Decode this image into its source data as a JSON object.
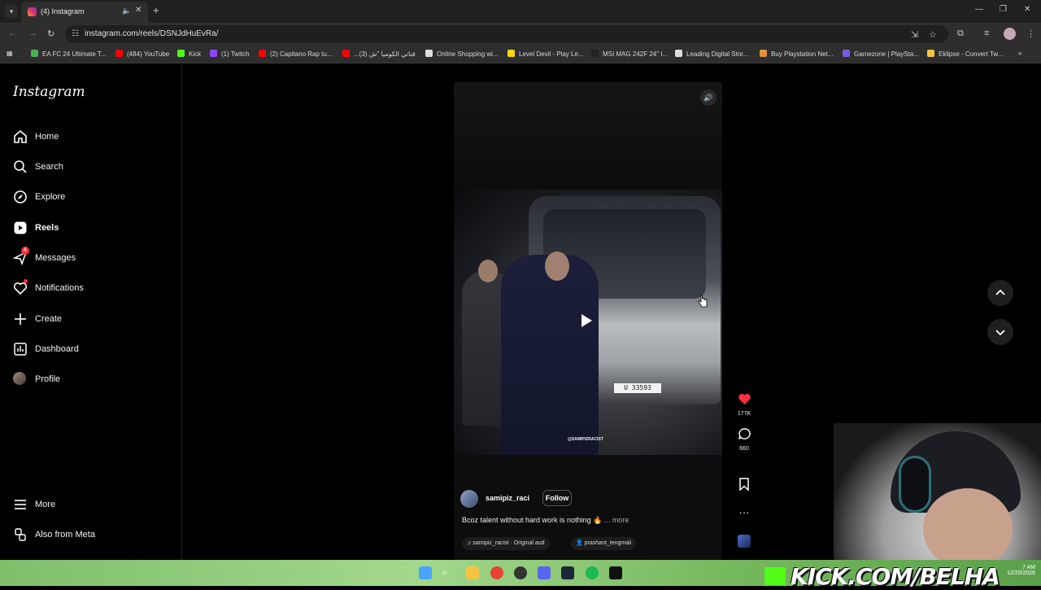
{
  "browser": {
    "tab_title": "(4) Instagram",
    "url": "instagram.com/reels/DSNJdHuEvRa/",
    "bookmarks": [
      {
        "label": "EA FC 24 Ultimate T...",
        "color": "#4caf50"
      },
      {
        "label": "(484) YouTube",
        "color": "#ff0000"
      },
      {
        "label": "Kick",
        "color": "#53fc18"
      },
      {
        "label": "(1) Twitch",
        "color": "#9146ff"
      },
      {
        "label": "(2) Capitano Rap tu...",
        "color": "#ff0000"
      },
      {
        "label": "...قناتي الكوميا \"ش (3)",
        "color": "#ff0000"
      },
      {
        "label": "Online Shopping wi...",
        "color": "#dddddd"
      },
      {
        "label": "Level Devil - Play Le...",
        "color": "#f5d90a"
      },
      {
        "label": "MSI MAG 242F 24\" I...",
        "color": "#222222"
      },
      {
        "label": "Leading Digital Stor...",
        "color": "#dddddd"
      },
      {
        "label": "Buy Playstation Net...",
        "color": "#e0913a"
      },
      {
        "label": "Gamezone | PlaySta...",
        "color": "#7a5ce0"
      },
      {
        "label": "Eklipse - Convert Tw...",
        "color": "#f5c542"
      }
    ]
  },
  "sidebar": {
    "logo": "Instagram",
    "items": [
      {
        "label": "Home",
        "icon": "home-icon"
      },
      {
        "label": "Search",
        "icon": "search-icon"
      },
      {
        "label": "Explore",
        "icon": "explore-icon"
      },
      {
        "label": "Reels",
        "icon": "reels-icon",
        "active": true
      },
      {
        "label": "Messages",
        "icon": "messages-icon",
        "badge": "4"
      },
      {
        "label": "Notifications",
        "icon": "heart-icon"
      },
      {
        "label": "Create",
        "icon": "plus-icon"
      },
      {
        "label": "Dashboard",
        "icon": "dashboard-icon"
      },
      {
        "label": "Profile",
        "icon": "avatar"
      }
    ],
    "more": "More",
    "meta": "Also from Meta"
  },
  "reel": {
    "watermark": "@SAMIPIZRACIST",
    "plate": "U 33593",
    "author": "samipiz_raci",
    "follow": "Follow",
    "caption": "Bcoz talent without hard work is nothing 🔥",
    "caption_more": "... more",
    "audio": "samipiz_racist · Original aud",
    "tagged": "prashant_tengmali"
  },
  "actions": {
    "likes": "177K",
    "comments": "660",
    "like_color": "#ff3040"
  },
  "overlay": {
    "kick_text": "KICK.COM/BELHA",
    "clock_time": "7 AM",
    "clock_date": "12/20/2026"
  }
}
